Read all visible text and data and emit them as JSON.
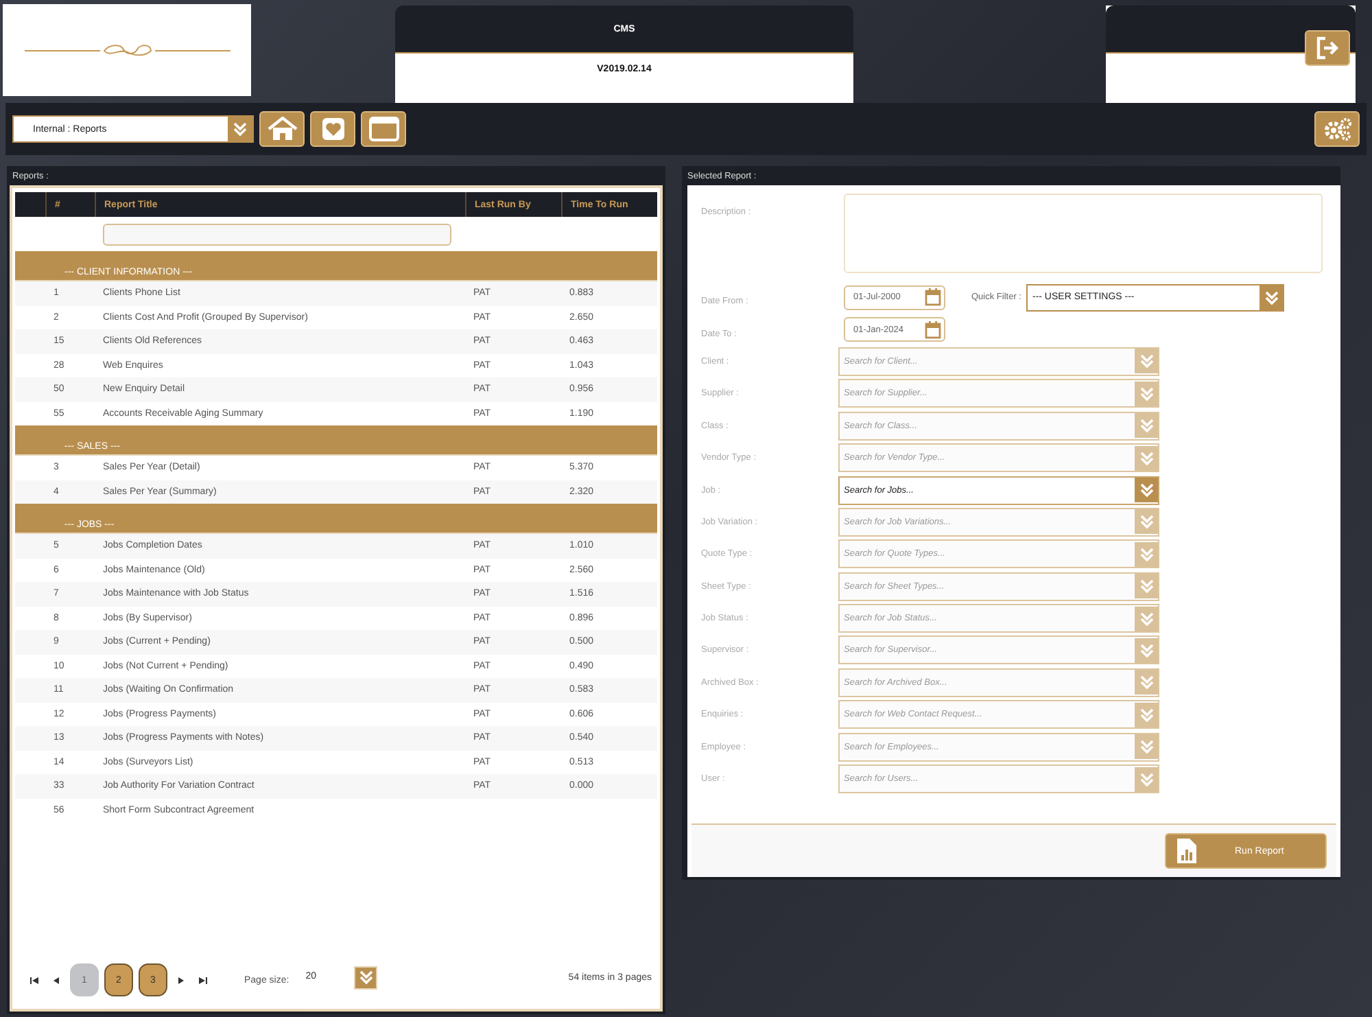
{
  "header": {
    "title": "CMS",
    "version": "V2019.02.14"
  },
  "toolbar": {
    "module": "Internal : Reports"
  },
  "reports_panel": {
    "title": "Reports :",
    "columns": [
      "#",
      "Report Title",
      "Last Run By",
      "Time To Run"
    ],
    "rows": [
      {
        "kind": "group",
        "title": "--- CLIENT INFORMATION ---"
      },
      {
        "kind": "row",
        "num": "1",
        "title": "Clients Phone List",
        "by": "PAT",
        "time": "0.883"
      },
      {
        "kind": "row",
        "num": "2",
        "title": "Clients Cost And Profit (Grouped By Supervisor)",
        "by": "PAT",
        "time": "2.650"
      },
      {
        "kind": "row",
        "num": "15",
        "title": "Clients Old References",
        "by": "PAT",
        "time": "0.463"
      },
      {
        "kind": "row",
        "num": "28",
        "title": "Web Enquires",
        "by": "PAT",
        "time": "1.043"
      },
      {
        "kind": "row",
        "num": "50",
        "title": "New Enquiry Detail",
        "by": "PAT",
        "time": "0.956"
      },
      {
        "kind": "row",
        "num": "55",
        "title": "Accounts Receivable Aging Summary",
        "by": "PAT",
        "time": "1.190"
      },
      {
        "kind": "group",
        "title": "--- SALES ---"
      },
      {
        "kind": "row",
        "num": "3",
        "title": "Sales Per Year (Detail)",
        "by": "PAT",
        "time": "5.370"
      },
      {
        "kind": "row",
        "num": "4",
        "title": "Sales Per Year (Summary)",
        "by": "PAT",
        "time": "2.320"
      },
      {
        "kind": "group",
        "title": "--- JOBS ---"
      },
      {
        "kind": "row",
        "num": "5",
        "title": "Jobs Completion Dates",
        "by": "PAT",
        "time": "1.010"
      },
      {
        "kind": "row",
        "num": "6",
        "title": "Jobs Maintenance (Old)",
        "by": "PAT",
        "time": "2.560"
      },
      {
        "kind": "row",
        "num": "7",
        "title": "Jobs Maintenance with Job Status",
        "by": "PAT",
        "time": "1.516"
      },
      {
        "kind": "row",
        "num": "8",
        "title": "Jobs (By Supervisor)",
        "by": "PAT",
        "time": "0.896"
      },
      {
        "kind": "row",
        "num": "9",
        "title": "Jobs (Current + Pending)",
        "by": "PAT",
        "time": "0.500"
      },
      {
        "kind": "row",
        "num": "10",
        "title": "Jobs (Not Current + Pending)",
        "by": "PAT",
        "time": "0.490"
      },
      {
        "kind": "row",
        "num": "11",
        "title": "Jobs (Waiting On Confirmation",
        "by": "PAT",
        "time": "0.583"
      },
      {
        "kind": "row",
        "num": "12",
        "title": "Jobs (Progress Payments)",
        "by": "PAT",
        "time": "0.606"
      },
      {
        "kind": "row",
        "num": "13",
        "title": "Jobs (Progress Payments with Notes)",
        "by": "PAT",
        "time": "0.540"
      },
      {
        "kind": "row",
        "num": "14",
        "title": "Jobs (Surveyors List)",
        "by": "PAT",
        "time": "0.513"
      },
      {
        "kind": "row",
        "num": "33",
        "title": "Job Authority For Variation Contract",
        "by": "PAT",
        "time": "0.000"
      },
      {
        "kind": "row",
        "num": "56",
        "title": "Short Form Subcontract Agreement"
      }
    ],
    "pages": [
      {
        "label": "1",
        "selected": true
      },
      {
        "label": "2",
        "selected": false
      },
      {
        "label": "3",
        "selected": false
      }
    ],
    "page_size_label": "Page size:",
    "page_size": "20",
    "summary": "54 items in 3 pages"
  },
  "selected_panel": {
    "title": "Selected Report :",
    "description_label": "Description :",
    "date_from": {
      "label": "Date From :",
      "value": "01-Jul-2000"
    },
    "quick_filter": {
      "label": "Quick Filter :",
      "value": "--- USER SETTINGS ---"
    },
    "date_to": {
      "label": "Date To :",
      "value": "01-Jan-2024"
    },
    "filters": [
      {
        "label": "Client :",
        "placeholder": "Search for Client...",
        "active": false
      },
      {
        "label": "Supplier :",
        "placeholder": "Search for Supplier...",
        "active": false
      },
      {
        "label": "Class :",
        "placeholder": "Search for Class...",
        "active": false
      },
      {
        "label": "Vendor Type :",
        "placeholder": "Search for Vendor Type...",
        "active": false
      },
      {
        "label": "Job :",
        "placeholder": "Search for Jobs...",
        "active": true
      },
      {
        "label": "Job Variation :",
        "placeholder": "Search for Job Variations...",
        "active": false
      },
      {
        "label": "Quote Type :",
        "placeholder": "Search for Quote Types...",
        "active": false
      },
      {
        "label": "Sheet Type :",
        "placeholder": "Search for Sheet Types...",
        "active": false
      },
      {
        "label": "Job Status :",
        "placeholder": "Search for Job Status...",
        "active": false
      },
      {
        "label": "Supervisor :",
        "placeholder": "Search for Supervisor...",
        "active": false
      },
      {
        "label": "Archived Box :",
        "placeholder": "Search for Archived Box...",
        "active": false
      },
      {
        "label": "Enquiries :",
        "placeholder": "Search for Web Contact Request...",
        "active": false
      },
      {
        "label": "Employee :",
        "placeholder": "Search for Employees...",
        "active": false
      },
      {
        "label": "User :",
        "placeholder": "Search for Users...",
        "active": false
      }
    ],
    "run_button": "Run Report"
  }
}
